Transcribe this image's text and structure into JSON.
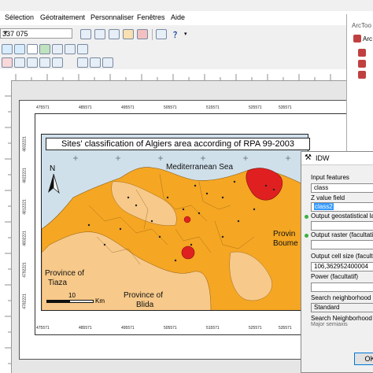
{
  "menubar": {
    "items": [
      "Sélection",
      "Géotraitement",
      "Personnaliser",
      "Fenêtres",
      "Aide"
    ]
  },
  "toolbar": {
    "scale_value": "337 075"
  },
  "catalog": {
    "title": "ArcToo",
    "item": "Arc"
  },
  "map": {
    "title": "Sites' classification of Algiers area according of RPA 99-2003",
    "north_label": "N",
    "scale_number": "10",
    "scale_unit": "Km",
    "labels": {
      "sea": "Mediterranean Sea",
      "tiaza_line1": "Province of",
      "tiaza_line2": "Tiaza",
      "blida_line1": "Province of",
      "blida_line2": "Blida",
      "boumerdes_line1": "Provin",
      "boumerdes_line2": "Boume"
    },
    "x_coords": [
      "475571",
      "485571",
      "495571",
      "505571",
      "515571",
      "525571",
      "535571"
    ],
    "y_coords": [
      "4832221",
      "4822221",
      "4812221",
      "4802221",
      "4792221",
      "4782221"
    ],
    "colors": {
      "sea": "#cfe0ea",
      "zone_orange": "#f5a623",
      "zone_light": "#f7c98a",
      "zone_red": "#e02020"
    }
  },
  "idw": {
    "title": "IDW",
    "input_features_label": "Input features",
    "input_features_value": "class",
    "z_value_label": "Z value field",
    "z_value_value": "class2",
    "output_geo_label": "Output geostatistical lay",
    "output_raster_label": "Output raster (facultati",
    "output_raster_value": "",
    "cell_size_label": "Output cell size (facultat",
    "cell_size_value": "106,362952400004",
    "power_label": "Power (facultatif)",
    "power_value": "",
    "search_label": "Search neighborhood (f",
    "search_type": "Standard",
    "search_neighborhood_label": "Search Neighborhood",
    "major_semiaxis_label": "Major semiaxis",
    "ok_label": "OK"
  }
}
